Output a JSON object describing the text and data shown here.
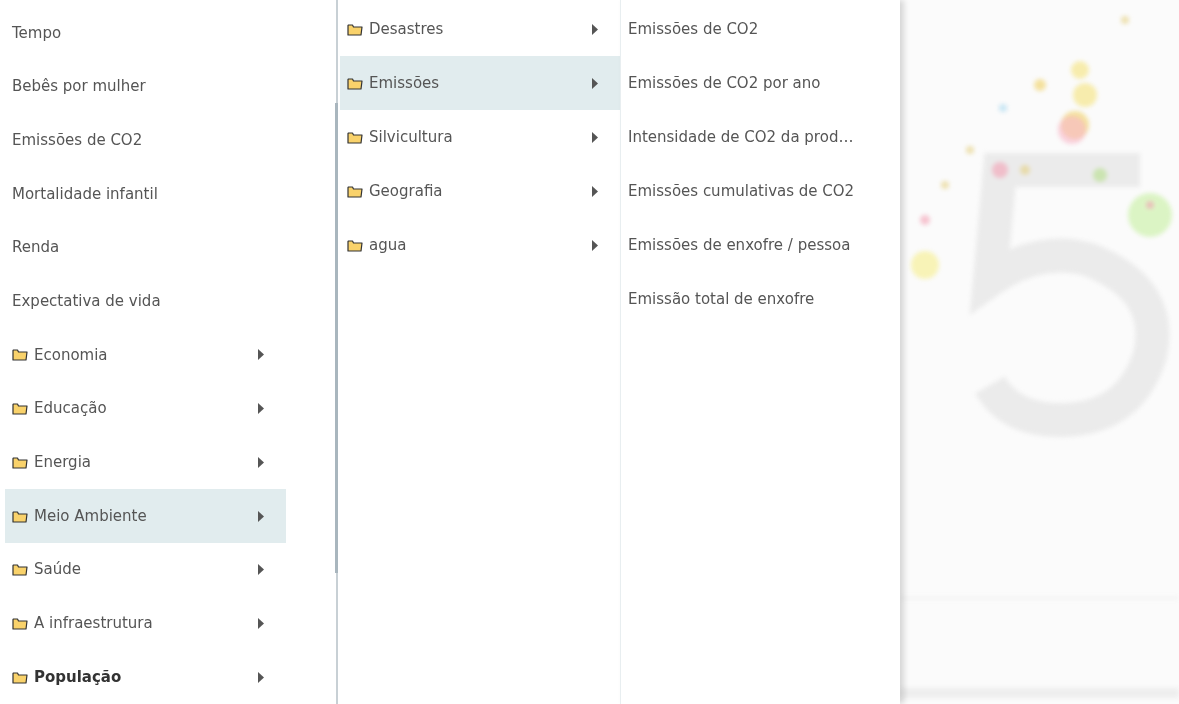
{
  "menu": {
    "items": [
      {
        "kind": "plain",
        "label": "Tempo",
        "selected": false,
        "emphasized": false
      },
      {
        "kind": "plain",
        "label": "Bebês por mulher",
        "selected": false,
        "emphasized": false
      },
      {
        "kind": "plain",
        "label": "Emissões de CO2",
        "selected": false,
        "emphasized": false
      },
      {
        "kind": "plain",
        "label": "Mortalidade infantil",
        "selected": false,
        "emphasized": false
      },
      {
        "kind": "plain",
        "label": "Renda",
        "selected": false,
        "emphasized": false
      },
      {
        "kind": "plain",
        "label": "Expectativa de vida",
        "selected": false,
        "emphasized": false
      },
      {
        "kind": "folder",
        "label": "Economia",
        "selected": false,
        "emphasized": false
      },
      {
        "kind": "folder",
        "label": "Educação",
        "selected": false,
        "emphasized": false
      },
      {
        "kind": "folder",
        "label": "Energia",
        "selected": false,
        "emphasized": false
      },
      {
        "kind": "folder",
        "label": "Meio Ambiente",
        "selected": true,
        "emphasized": false
      },
      {
        "kind": "folder",
        "label": "Saúde",
        "selected": false,
        "emphasized": false
      },
      {
        "kind": "folder",
        "label": "A infraestrutura",
        "selected": false,
        "emphasized": false
      },
      {
        "kind": "folder",
        "label": "População",
        "selected": false,
        "emphasized": true
      }
    ]
  },
  "submenu": {
    "items": [
      {
        "kind": "folder",
        "label": "Desastres",
        "selected": false
      },
      {
        "kind": "folder",
        "label": "Emissões",
        "selected": true
      },
      {
        "kind": "folder",
        "label": "Silvicultura",
        "selected": false
      },
      {
        "kind": "folder",
        "label": "Geografia",
        "selected": false
      },
      {
        "kind": "folder",
        "label": "agua",
        "selected": false
      }
    ]
  },
  "indicators": {
    "items": [
      {
        "label": "Emissões de CO2"
      },
      {
        "label": "Emissões de CO2 por ano"
      },
      {
        "label": "Intensidade de CO2 da prod…"
      },
      {
        "label": "Emissões cumulativas de CO2"
      },
      {
        "label": "Emissões de enxofre / pessoa"
      },
      {
        "label": "Emissão total de enxofre"
      }
    ]
  }
}
